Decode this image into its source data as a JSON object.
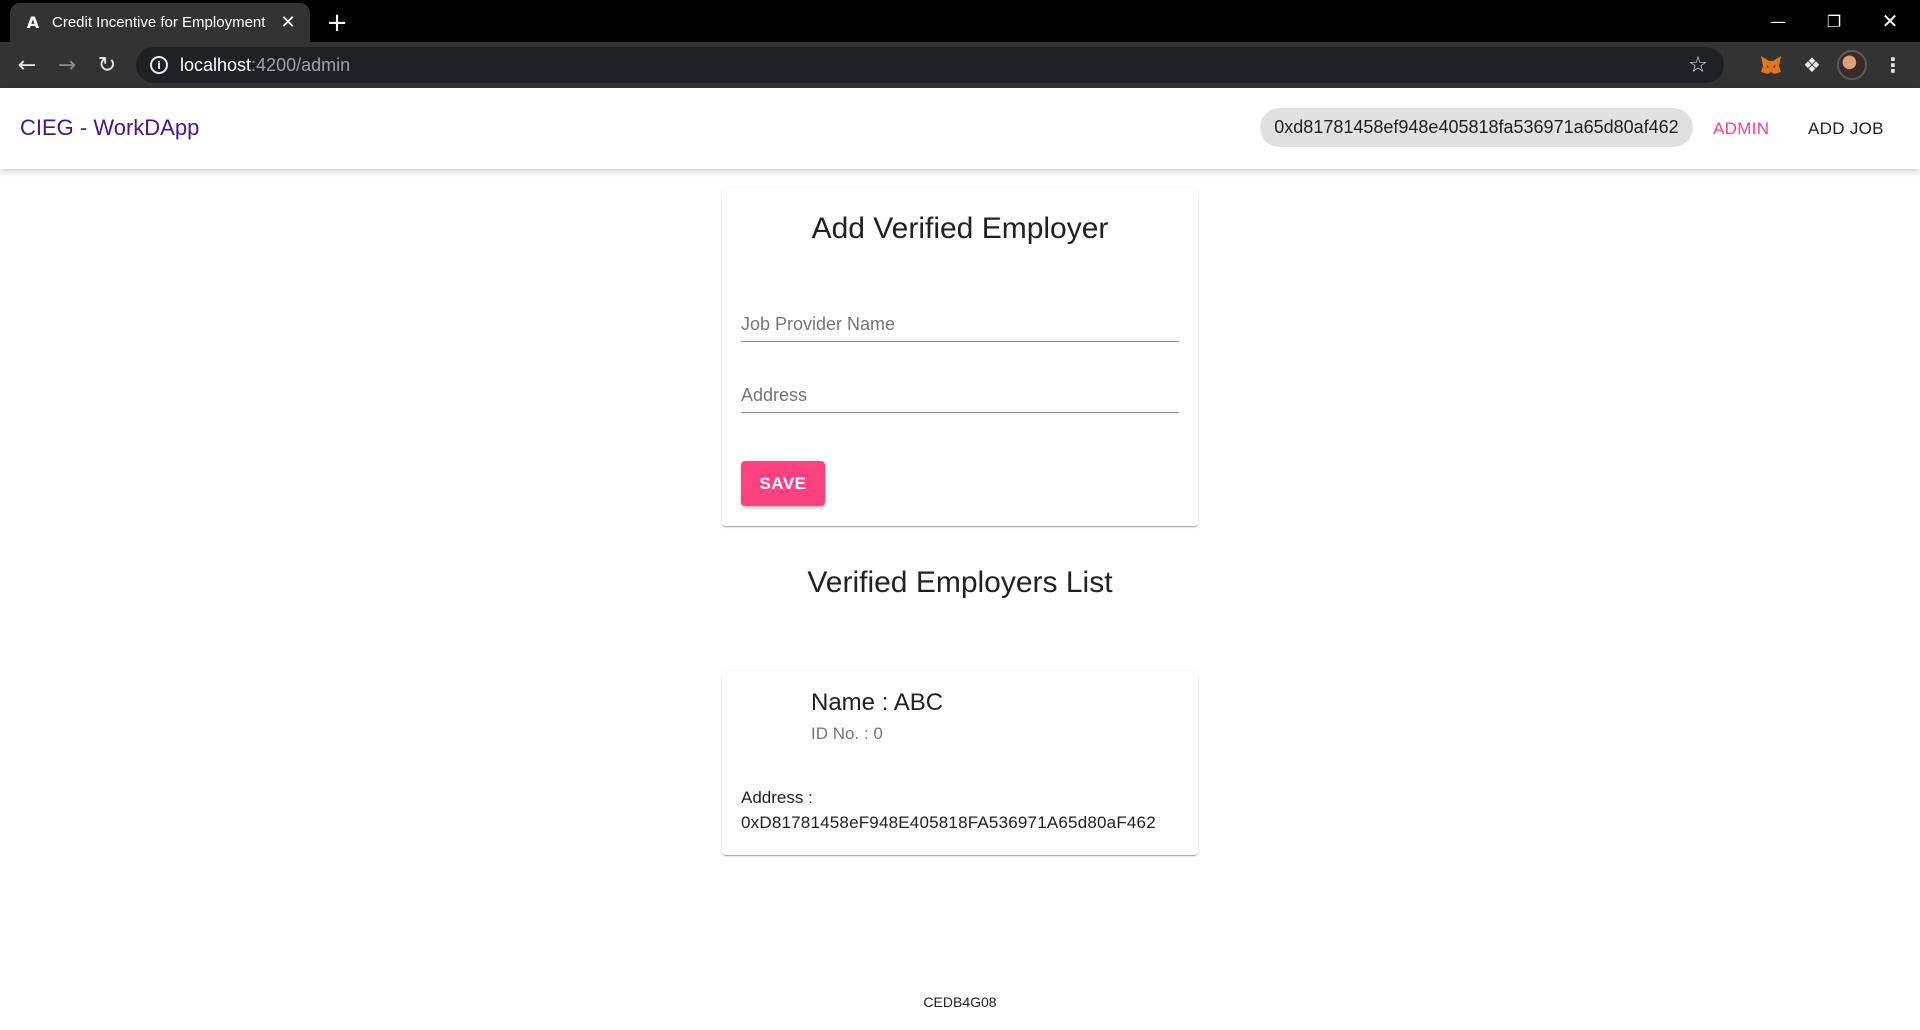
{
  "browser": {
    "tab_title": "Credit Incentive for Employment",
    "tab_favicon": "A",
    "new_tab_symbol": "+",
    "close_symbol": "✕",
    "url_host": "localhost",
    "url_path": ":4200/admin",
    "icons": {
      "back": "arrow-left-icon",
      "forward": "arrow-right-icon",
      "reload": "reload-icon",
      "info": "info-icon",
      "bookmark": "star-icon",
      "metamask": "fox-icon",
      "extensions": "puzzle-icon",
      "profile": "avatar",
      "menu": "kebab-menu-icon"
    }
  },
  "header": {
    "brand": "CIEG - WorkDApp",
    "wallet_address": "0xd81781458ef948e405818fa536971a65d80af462",
    "nav": {
      "admin": "ADMIN",
      "add_job": "ADD JOB"
    }
  },
  "form": {
    "title": "Add Verified Employer",
    "job_provider_name": {
      "placeholder": "Job Provider Name",
      "value": ""
    },
    "address": {
      "placeholder": "Address",
      "value": ""
    },
    "save_label": "SAVE"
  },
  "list": {
    "title": "Verified Employers List",
    "employers": [
      {
        "name": "Name : ABC",
        "id": "ID No. : 0",
        "address_label": "Address :",
        "address_value": "0xD81781458eF948E405818FA536971A65d80aF462"
      }
    ]
  },
  "footer": {
    "text": "CEDB4G08"
  },
  "colors": {
    "brand": "#4a148c",
    "accent": "#ff4081",
    "chip": "#e0e0e0"
  }
}
